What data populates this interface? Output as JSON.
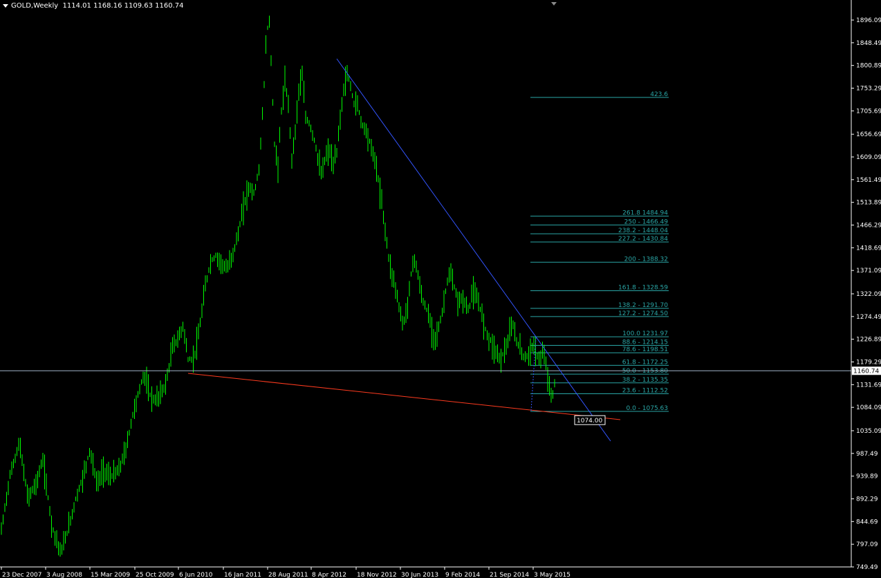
{
  "header": {
    "symbol": "GOLD,Weekly",
    "open": "1114.01",
    "high": "1168.16",
    "low": "1109.63",
    "close": "1160.74"
  },
  "chart_data": {
    "type": "bar",
    "title": "GOLD,Weekly",
    "y_axis": {
      "range": [
        749.49,
        1896.09
      ],
      "ticks": [
        "1896.09",
        "1848.49",
        "1800.89",
        "1753.29",
        "1705.69",
        "1656.69",
        "1609.09",
        "1561.49",
        "1513.89",
        "1466.29",
        "1418.69",
        "1371.09",
        "1322.09",
        "1274.49",
        "1226.89",
        "1179.29",
        "1131.69",
        "1084.09",
        "1035.09",
        "987.49",
        "939.89",
        "892.29",
        "844.69",
        "797.09",
        "749.49"
      ]
    },
    "x_axis": {
      "ticks": [
        "23 Dec 2007",
        "3 Aug 2008",
        "15 Mar 2009",
        "25 Oct 2009",
        "6 Jun 2010",
        "16 Jan 2011",
        "28 Aug 2011",
        "8 Apr 2012",
        "18 Nov 2012",
        "30 Jun 2013",
        "9 Feb 2014",
        "21 Sep 2014",
        "3 May 2015"
      ]
    },
    "current_price": {
      "value": 1160.74,
      "label": "1160.74"
    },
    "price_path": [
      [
        0,
        780
      ],
      [
        14,
        690
      ],
      [
        28,
        640
      ],
      [
        40,
        720
      ],
      [
        52,
        700
      ],
      [
        62,
        665
      ],
      [
        75,
        760
      ],
      [
        88,
        800
      ],
      [
        100,
        760
      ],
      [
        110,
        720
      ],
      [
        120,
        690
      ],
      [
        130,
        650
      ],
      [
        140,
        700
      ],
      [
        150,
        680
      ],
      [
        160,
        690
      ],
      [
        172,
        680
      ],
      [
        182,
        650
      ],
      [
        192,
        600
      ],
      [
        200,
        570
      ],
      [
        208,
        540
      ],
      [
        216,
        570
      ],
      [
        224,
        580
      ],
      [
        232,
        570
      ],
      [
        240,
        555
      ],
      [
        250,
        500
      ],
      [
        258,
        490
      ],
      [
        265,
        470
      ],
      [
        272,
        520
      ],
      [
        280,
        520
      ],
      [
        288,
        480
      ],
      [
        296,
        420
      ],
      [
        304,
        380
      ],
      [
        312,
        370
      ],
      [
        320,
        380
      ],
      [
        328,
        390
      ],
      [
        336,
        370
      ],
      [
        344,
        340
      ],
      [
        352,
        300
      ],
      [
        360,
        270
      ],
      [
        368,
        280
      ],
      [
        375,
        240
      ],
      [
        380,
        160
      ],
      [
        385,
        60
      ],
      [
        389,
        20
      ],
      [
        393,
        110
      ],
      [
        397,
        210
      ],
      [
        402,
        240
      ],
      [
        407,
        160
      ],
      [
        412,
        120
      ],
      [
        417,
        150
      ],
      [
        422,
        230
      ],
      [
        427,
        190
      ],
      [
        432,
        130
      ],
      [
        437,
        110
      ],
      [
        442,
        170
      ],
      [
        448,
        180
      ],
      [
        454,
        200
      ],
      [
        460,
        230
      ],
      [
        465,
        255
      ],
      [
        470,
        230
      ],
      [
        476,
        215
      ],
      [
        482,
        240
      ],
      [
        487,
        220
      ],
      [
        492,
        170
      ],
      [
        497,
        130
      ],
      [
        502,
        105
      ],
      [
        507,
        125
      ],
      [
        512,
        150
      ],
      [
        517,
        150
      ],
      [
        522,
        175
      ],
      [
        527,
        185
      ],
      [
        532,
        195
      ],
      [
        537,
        215
      ],
      [
        542,
        230
      ],
      [
        547,
        260
      ],
      [
        553,
        300
      ],
      [
        558,
        340
      ],
      [
        563,
        380
      ],
      [
        568,
        400
      ],
      [
        573,
        420
      ],
      [
        578,
        450
      ],
      [
        583,
        470
      ],
      [
        588,
        450
      ],
      [
        593,
        410
      ],
      [
        598,
        370
      ],
      [
        603,
        390
      ],
      [
        608,
        420
      ],
      [
        613,
        440
      ],
      [
        618,
        450
      ],
      [
        623,
        470
      ],
      [
        628,
        490
      ],
      [
        633,
        480
      ],
      [
        638,
        460
      ],
      [
        643,
        430
      ],
      [
        648,
        400
      ],
      [
        653,
        400
      ],
      [
        658,
        420
      ],
      [
        663,
        440
      ],
      [
        668,
        430
      ],
      [
        673,
        440
      ],
      [
        678,
        450
      ],
      [
        683,
        420
      ],
      [
        688,
        430
      ],
      [
        693,
        440
      ],
      [
        698,
        460
      ],
      [
        703,
        480
      ],
      [
        708,
        490
      ],
      [
        713,
        500
      ],
      [
        718,
        510
      ],
      [
        723,
        520
      ],
      [
        728,
        510
      ],
      [
        733,
        500
      ],
      [
        738,
        480
      ],
      [
        742,
        470
      ],
      [
        746,
        490
      ],
      [
        750,
        500
      ],
      [
        755,
        510
      ],
      [
        760,
        520
      ],
      [
        765,
        510
      ],
      [
        770,
        500
      ],
      [
        775,
        510
      ],
      [
        780,
        520
      ],
      [
        785,
        510
      ],
      [
        790,
        530
      ],
      [
        795,
        560
      ],
      [
        798,
        580
      ],
      [
        800,
        570
      ],
      [
        803,
        545
      ]
    ],
    "fibonacci_levels": [
      {
        "label": "423.6",
        "price": null,
        "level_price": 1734
      },
      {
        "label": "261.8 1484.94",
        "level_price": 1484.94
      },
      {
        "label": "250 - 1466.49",
        "level_price": 1466.49
      },
      {
        "label": "238.2 - 1448.04",
        "level_price": 1448.04
      },
      {
        "label": "227.2 - 1430.84",
        "level_price": 1430.84
      },
      {
        "label": "200 - 1388.32",
        "level_price": 1388.32
      },
      {
        "label": "161.8 - 1328.59",
        "level_price": 1328.59
      },
      {
        "label": "138.2 - 1291.70",
        "level_price": 1291.7
      },
      {
        "label": "127.2 - 1274.50",
        "level_price": 1274.5
      },
      {
        "label": "100.0 1231.97",
        "level_price": 1231.97
      },
      {
        "label": "88.6 - 1214.15",
        "level_price": 1214.15
      },
      {
        "label": "78.6 - 1198.51",
        "level_price": 1198.51
      },
      {
        "label": "61.8 - 1172.25",
        "level_price": 1172.25
      },
      {
        "label": "50.0 - 1153.80",
        "level_price": 1153.8
      },
      {
        "label": "38.2 - 1135.35",
        "level_price": 1135.35
      },
      {
        "label": "23.6 - 1112.52",
        "level_price": 1112.52
      },
      {
        "label": "0.0 - 1075.63",
        "level_price": 1075.63
      }
    ],
    "price_callout": {
      "label": "1074.00",
      "value": 1074.0
    },
    "colors": {
      "bars": "#00ff00",
      "fib": "#2aa6a6",
      "downtrend": "#3355ff",
      "support": "#ff3b1f",
      "price_line": "#9fb3c8"
    }
  }
}
